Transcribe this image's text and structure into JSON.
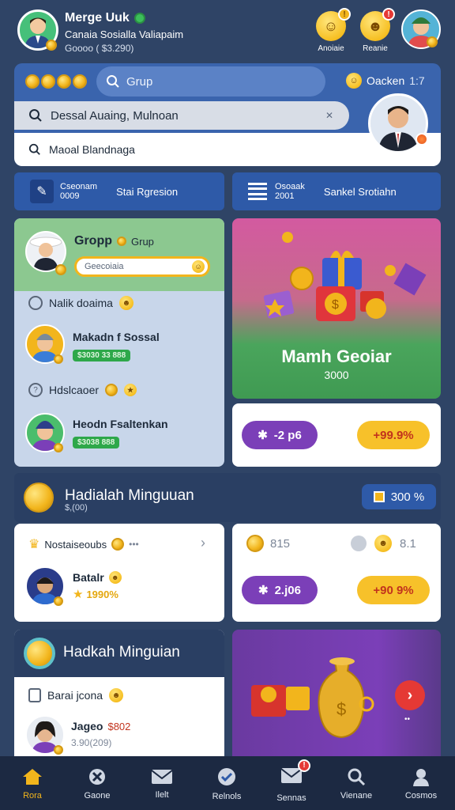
{
  "header": {
    "user_name": "Merge Uuk",
    "subtitle": "Canaia Sosialla Valiapaim",
    "sub2": "Goooo ( $3.290)",
    "right_actions": [
      {
        "label": "Anoiaie",
        "badge": "!"
      },
      {
        "label": "Reanie",
        "badge": "!"
      }
    ]
  },
  "search_panel": {
    "group_placeholder": "Grup",
    "status_label": "Oacken",
    "status_value": "1:7",
    "search_value": "Dessal Auaing, Mulnoan",
    "sub_search": "Maoal Blandnaga"
  },
  "quick_tabs": [
    {
      "title": "Cseonam",
      "sub": "0009",
      "label": "Stai Rgresion"
    },
    {
      "title": "Osoaak",
      "sub": "2001",
      "label": "Sankel Srotiahn"
    }
  ],
  "group_card": {
    "title": "Gropp",
    "tag": "Grup",
    "input_value": "Geecoiaia",
    "items": [
      {
        "title": "Nalik doaima",
        "type": "header"
      },
      {
        "title": "Makadn f Sossal",
        "tag": "$3030 33 888"
      },
      {
        "title": "Hdslcaoer",
        "type": "header"
      },
      {
        "title": "Heodn Fsaltenkan",
        "tag": "$3038 888"
      }
    ]
  },
  "promo_card": {
    "title": "Mamh Geoiar",
    "value": "3000"
  },
  "promo_pills_1": {
    "left": "-2 p6",
    "right": "+99.9%"
  },
  "weekly": {
    "title": "Hadialah Minguuan",
    "sub": "$,(00)",
    "percent": "300 %"
  },
  "mini_card_left": {
    "title": "Nostaiseoubs",
    "person": "Batalr",
    "person_value": "1990%"
  },
  "mini_card_right": {
    "coin_value": "815",
    "react_value": "8.1",
    "left": "2.j06",
    "right": "+90 9%"
  },
  "bottom_section": {
    "title": "Hadkah Minguian",
    "item": "Barai jcona",
    "person": "Jageo",
    "person_value": "$802",
    "person_sub": "3.90(209)",
    "dots": "••"
  },
  "nav": [
    {
      "label": "Rora",
      "icon": "home-icon",
      "active": true
    },
    {
      "label": "Gaone",
      "icon": "tools-icon"
    },
    {
      "label": "Ilelt",
      "icon": "mail-icon"
    },
    {
      "label": "Relnols",
      "icon": "check-badge-icon"
    },
    {
      "label": "Sennas",
      "icon": "inbox-icon",
      "badge": "!"
    },
    {
      "label": "Vienane",
      "icon": "search-icon"
    },
    {
      "label": "Cosmos",
      "icon": "profile-icon"
    }
  ],
  "colors": {
    "background": "#2f4466",
    "accent_blue": "#2e5aa8",
    "gold": "#f2b51c",
    "purple": "#7b3fb8",
    "green": "#2ea84a",
    "red": "#e53935"
  }
}
